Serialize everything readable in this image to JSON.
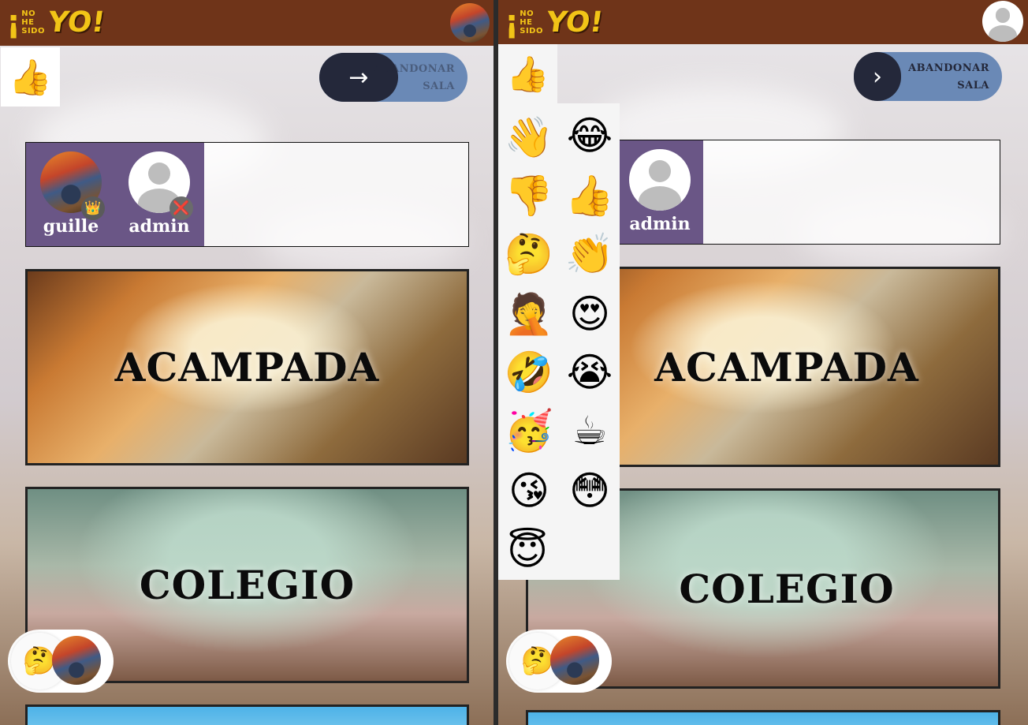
{
  "app": {
    "logo_small": [
      "NO",
      "HE",
      "SIDO"
    ],
    "logo_exclaim": "¡",
    "logo_big": "YO!"
  },
  "left_panel": {
    "thumb_button": "👍",
    "leave_button": {
      "arrow": "→",
      "label": "ABANDONAR SALA"
    },
    "players": [
      {
        "name": "guille",
        "badge": "👑",
        "avatar": "scream"
      },
      {
        "name": "admin",
        "badge": "❌",
        "avatar": "default"
      }
    ],
    "rooms": [
      "ACAMPADA",
      "COLEGIO",
      ""
    ],
    "reaction": "🤔"
  },
  "right_panel": {
    "thumb_button": "👍",
    "leave_button": {
      "arrow": "›",
      "label": "ABANDONAR SALA"
    },
    "players": [
      {
        "name": "admin",
        "avatar": "default"
      }
    ],
    "rooms": [
      "ACAMPADA",
      "COLEGIO",
      ""
    ],
    "reaction": "🤔",
    "emoji_picker": [
      "👋",
      "😂",
      "👎",
      "👍",
      "🤔",
      "👏",
      "🤦",
      "😍",
      "🤣",
      "😭",
      "🥳",
      "☕",
      "😘",
      "😳",
      "😇"
    ]
  },
  "colors": {
    "topbar": "#6f3419",
    "logo": "#f2c417",
    "players_strip": "#6a5686",
    "leave_button": "#6a89b6",
    "leave_circle": "#24283a"
  }
}
